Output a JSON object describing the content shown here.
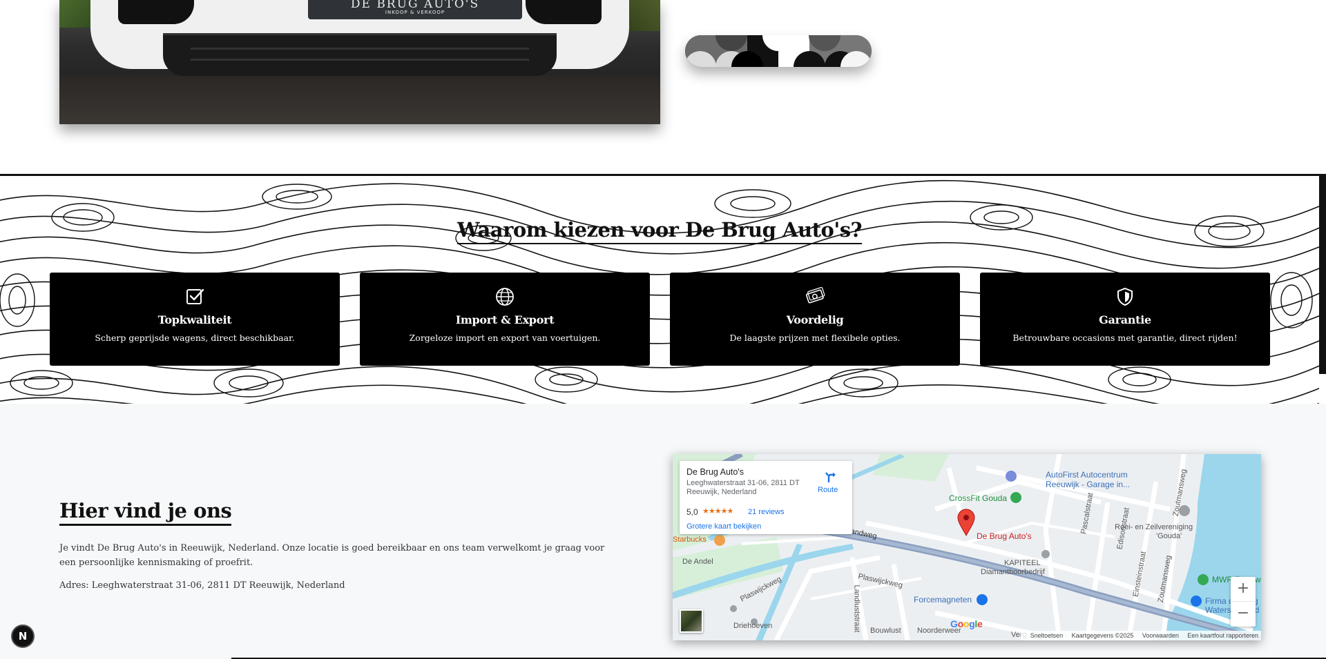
{
  "hero": {
    "plate_name": "DE BRUG AUTO'S",
    "plate_sub": "INKOOP & VERKOOP"
  },
  "features": {
    "title": "Waarom kiezen voor De Brug Auto's?",
    "cards": [
      {
        "icon": "checkbox-icon",
        "title": "Topkwaliteit",
        "text": "Scherp geprijsde wagens, direct beschikbaar."
      },
      {
        "icon": "globe-icon",
        "title": "Import & Export",
        "text": "Zorgeloze import en export van voertuigen."
      },
      {
        "icon": "money-icon",
        "title": "Voordelig",
        "text": "De laagste prijzen met flexibele opties."
      },
      {
        "icon": "shield-icon",
        "title": "Garantie",
        "text": "Betrouwbare occasions met garantie, direct rijden!"
      }
    ]
  },
  "location": {
    "title": "Hier vind je ons",
    "text": "Je vindt De Brug Auto's in Reeuwijk, Nederland. Onze locatie is goed bereikbaar en ons team verwelkomt je graag voor een persoonlijke kennismaking of proefrit.",
    "address": "Adres: Leeghwaterstraat 31-06, 2811 DT Reeuwijk, Nederland"
  },
  "map": {
    "info": {
      "name": "De Brug Auto's",
      "address": "Leeghwaterstraat 31-06, 2811 DT Reeuwijk, Nederland",
      "rating": "5,0",
      "stars": "★★★★★",
      "reviews": "21 reviews",
      "bigger_map": "Grotere kaart bekijken",
      "route": "Route"
    },
    "labels": {
      "autofirst": "AutoFirst Autocentrum",
      "autofirst_sub": "Reeuwijk - Garage in...",
      "crossfit": "CrossFit Gouda",
      "debrug": "De Brug Auto's",
      "roei": "Roei- en Zeilvereniging",
      "roei_sub": "'Gouda'",
      "kapiteel": "KAPITEEL",
      "kapiteel_sub": "Diamantboorbedrijf",
      "mwr": "MWR Reeuwijk",
      "firma": "Firma de Jong",
      "firma_sub": "Watersportbed",
      "starbucks": "Starbucks",
      "forcemagneten": "Forcemagneten",
      "randweg": "...rijkse Randweg",
      "deandel": "De Andel",
      "plaswijckweg1": "Plaswijckweg",
      "plaswijckweg2": "Plaswijckweg",
      "driehoeven": "Driehoeven",
      "landluststraat": "Landluststraat",
      "bouwlust": "Bouwlust",
      "noorderweer": "Noorderweer",
      "verg": "Verg",
      "pascalstraat": "Pascalstraat",
      "edisonstraat": "Edisonstraat",
      "einsteinstraat": "Einsteinstraat",
      "zoutmansweg1": "Zoutmansweg",
      "zoutmansweg2": "Zoutmansweg"
    },
    "zoom_in": "+",
    "zoom_out": "−",
    "footer": {
      "shortcuts": "Sneltoetsen",
      "data": "Kaartgegevens ©2025",
      "terms": "Voorwaarden",
      "report": "Een kaartfout rapporteren"
    }
  },
  "next_badge": "N"
}
